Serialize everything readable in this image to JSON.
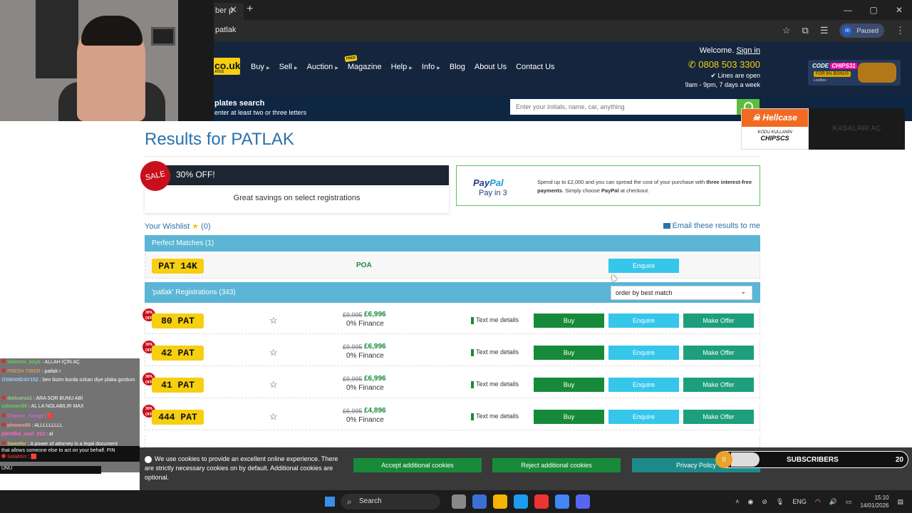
{
  "browser": {
    "tab_title": "ber p",
    "tab_close": "✕",
    "new_tab": "+",
    "url": "patlak",
    "profile_initial": "m",
    "profile_status": "Paused",
    "window_buttons": [
      "—",
      "▢",
      "✕"
    ]
  },
  "header": {
    "logo_text": "co.uk",
    "logo_sub": "ATES",
    "nav": [
      {
        "label": "Buy",
        "has_caret": true
      },
      {
        "label": "Sell",
        "has_caret": true
      },
      {
        "label": "Auction",
        "has_caret": true
      },
      {
        "label": "Magazine",
        "has_caret": false,
        "badge": "FREE"
      },
      {
        "label": "Help",
        "has_caret": true
      },
      {
        "label": "Info",
        "has_caret": true
      },
      {
        "label": "Blog",
        "has_caret": false
      },
      {
        "label": "About Us",
        "has_caret": false
      },
      {
        "label": "Contact Us",
        "has_caret": false
      }
    ],
    "welcome": "Welcome.",
    "sign_in": "Sign in",
    "phone": "0808 503 3300",
    "lines_open": "Lines are open",
    "hours": "9am - 9pm, 7 days a week"
  },
  "promo": {
    "code_label": "CODE",
    "code": "CHIPS31",
    "bonus": "FOR 8% BONUS",
    "brand": "Lootbox"
  },
  "search": {
    "title": "plates search",
    "subtitle": "enter at least two or three letters",
    "placeholder": "Enter your initials, name, car, anything"
  },
  "hellcase": {
    "brand": "Hellcase",
    "code_label": "KODU KULLANIN",
    "code": "CHIPSCS",
    "cta": "KASALARI AÇ"
  },
  "main": {
    "title": "Results for PATLAK",
    "sale": {
      "badge": "SALE",
      "off": "30% OFF!",
      "subtitle": "Great savings on select registrations"
    },
    "paypal": {
      "logo_a": "Pay",
      "logo_b": "Pal",
      "in3": "Pay in 3",
      "text_a": "Spend up to £2,000 and you can spread the cost of your purchase with ",
      "text_bold": "three interest-free payments",
      "text_b": ". Simply choose ",
      "text_bold2": "PayPal",
      "text_c": " at checkout."
    },
    "wishlist_label": "Your Wishlist",
    "wishlist_count": "(0)",
    "email_link": "Email these results to me",
    "perfect_matches": "Perfect Matches (1)",
    "match": {
      "plate": "PAT 14K",
      "price": "POA",
      "enquire": "Enquire"
    },
    "registrations_header": "'patlak' Registrations (343)",
    "order_by": "order by best match",
    "rows": [
      {
        "badge": "30% OFF",
        "plate": "80 PAT",
        "old_price": "£9,995",
        "new_price": "£6,996",
        "finance": "0% Finance"
      },
      {
        "badge": "30% OFF",
        "plate": "42 PAT",
        "old_price": "£9,995",
        "new_price": "£6,996",
        "finance": "0% Finance"
      },
      {
        "badge": "30% OFF",
        "plate": "41 PAT",
        "old_price": "£9,995",
        "new_price": "£6,996",
        "finance": "0% Finance"
      },
      {
        "badge": "30% OFF",
        "plate": "444 PAT",
        "old_price": "£6,995",
        "new_price": "£4,896",
        "finance": "0% Finance"
      }
    ],
    "row_actions": {
      "text_me": "Text me details",
      "buy": "Buy",
      "enquire": "Enquire",
      "offer": "Make Offer"
    }
  },
  "cookie": {
    "text": "We use cookies to provide an excellent online experience. There are strictly necessary cookies on by default. Additional cookies are optional.",
    "accept": "Accept additional cookies",
    "reject": "Reject additional cookies",
    "privacy": "Privacy Policy"
  },
  "subscribers": {
    "label": "SUBSCRIBERS",
    "current": "0",
    "goal": "20",
    "progress": 0
  },
  "chat": [
    {
      "user": "Salmets_beyb",
      "msg": "ALLAH İÇİN AÇ",
      "color": "#6c6"
    },
    {
      "user": "FRESH TIBER",
      "msg": "patlak r",
      "color": "#c96"
    },
    {
      "user": "OSMANDAY152",
      "msg": "ben bizim burda ozkan diye plaka gordum",
      "color": "#9cf"
    },
    {
      "user": "dolicarus1",
      "msg": "ARA SOR BUNU ABİ",
      "color": "#9c9"
    },
    {
      "user": "calamari96",
      "msg": "AL LA NOLABİLİR MAX",
      "color": "#6c6"
    },
    {
      "user": "Chipsin_Yaragi",
      "msg": "🟥",
      "color": "#c6c"
    },
    {
      "user": "phonex66",
      "msg": "ALLLLLLLLL",
      "color": "#f99"
    },
    {
      "user": "plentiful_soul_012",
      "msg": "al",
      "color": "#f6c"
    },
    {
      "user": "Sweefer",
      "msg": "A power of attorney is a legal document",
      "color": "#cc6"
    }
  ],
  "chat_long": "that allows someone else to act on your behalf. PIN",
  "chat_last": {
    "user": "Selahtin",
    "msg": "🟥"
  },
  "chat_unu": "UNU",
  "taskbar": {
    "search": "Search",
    "lang": "ENG",
    "time": "15:10",
    "date": "14/01/2026",
    "app_colors": [
      "#888",
      "#3b6fd6",
      "#f4b400",
      "#1d9bf0",
      "#e33",
      "#4285f4",
      "#5865f2",
      "#e74c3c"
    ]
  }
}
